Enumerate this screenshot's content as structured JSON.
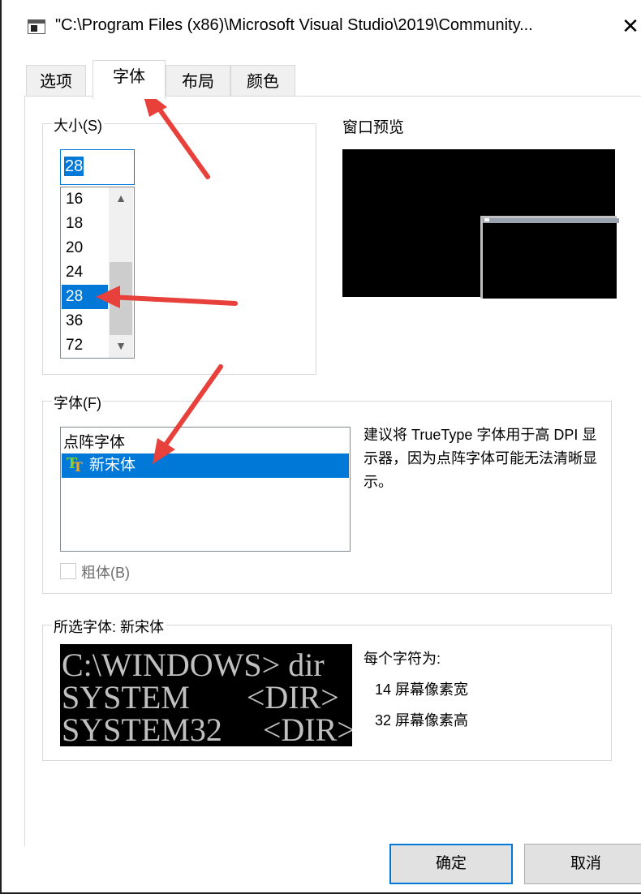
{
  "window": {
    "title": "\"C:\\Program Files (x86)\\Microsoft Visual Studio\\2019\\Community...",
    "close_glyph": "✕"
  },
  "tabs": [
    {
      "label": "选项",
      "active": false
    },
    {
      "label": "字体",
      "active": true
    },
    {
      "label": "布局",
      "active": false
    },
    {
      "label": "颜色",
      "active": false
    }
  ],
  "size_group": {
    "label": "大小(S)",
    "input_value": "28",
    "items": [
      "16",
      "18",
      "20",
      "24",
      "28",
      "36",
      "72"
    ],
    "selected": "28"
  },
  "preview": {
    "label": "窗口预览"
  },
  "font_group": {
    "label": "字体(F)",
    "items": [
      {
        "name": "点阵字体",
        "truetype": false
      },
      {
        "name": "新宋体",
        "truetype": true
      }
    ],
    "selected": "新宋体",
    "hint": "建议将 TrueType 字体用于高 DPI 显示器，因为点阵字体可能无法清晰显示。",
    "bold_label": "粗体(B)",
    "bold_checked": false
  },
  "selected_font": {
    "label": "所选字体: 新宋体",
    "sample_lines": [
      "C:\\WINDOWS> dir",
      "SYSTEM       <DIR>",
      "SYSTEM32     <DIR>"
    ],
    "char_info_title": "每个字符为:",
    "width_text": "14 屏幕像素宽",
    "height_text": "32 屏幕像素高"
  },
  "buttons": {
    "ok": "确定",
    "cancel": "取消"
  },
  "colors": {
    "accent": "#0078d7",
    "annotation_arrow": "#e8403a"
  }
}
